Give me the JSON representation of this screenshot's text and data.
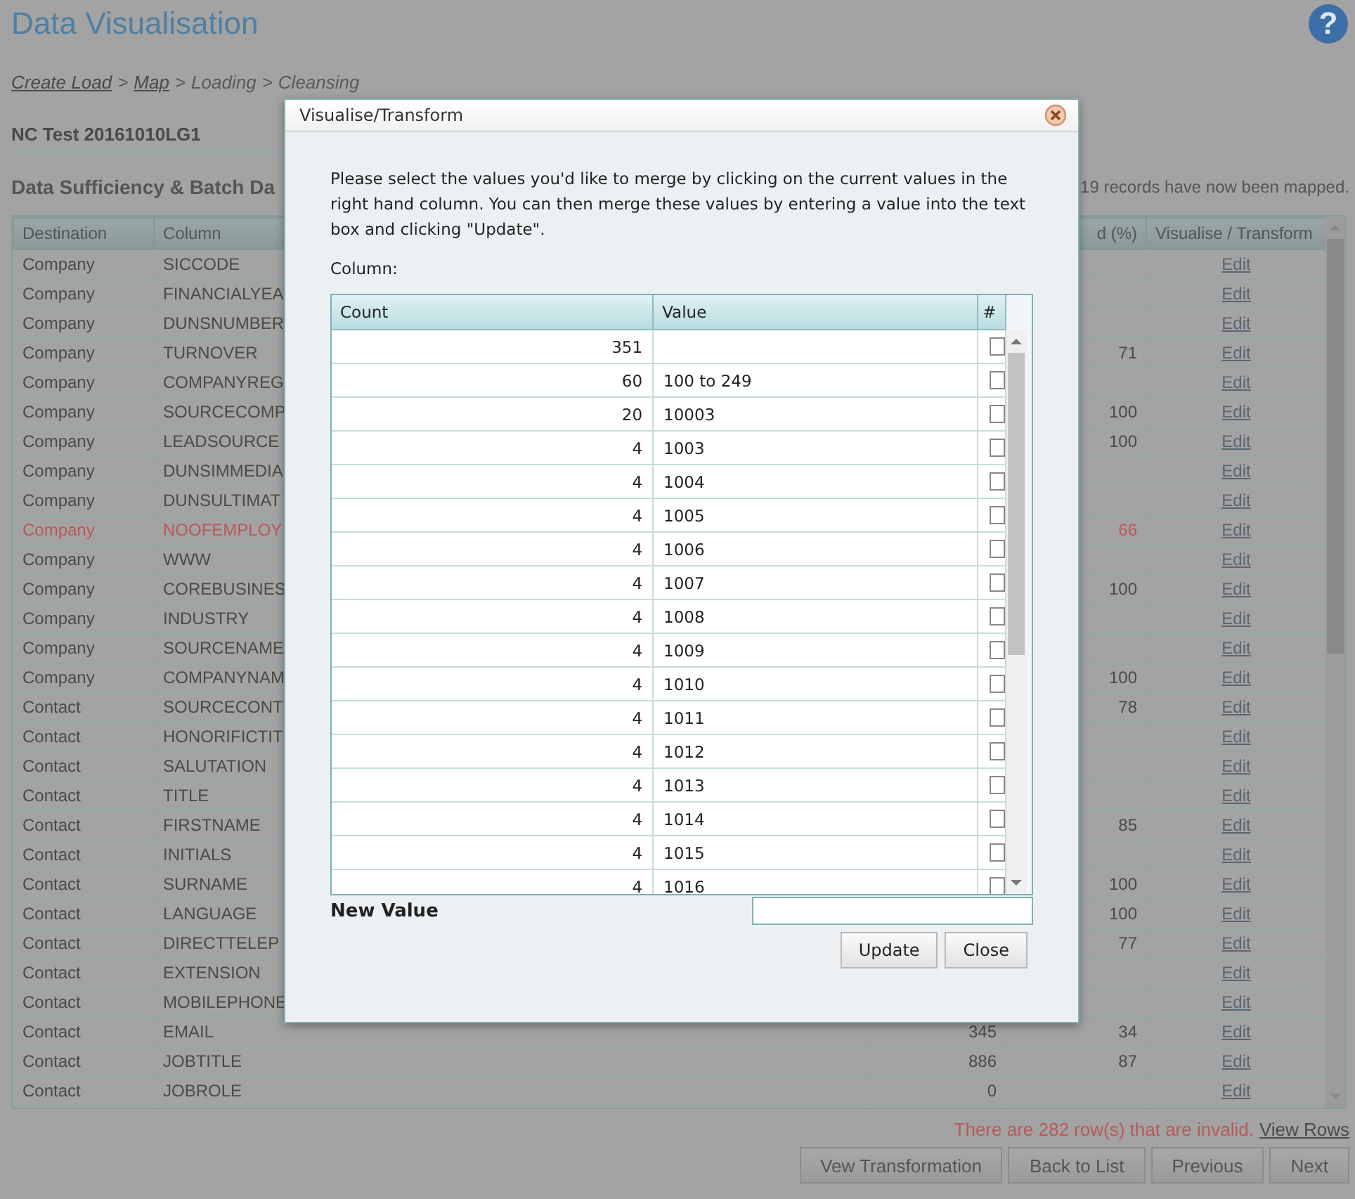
{
  "page": {
    "title": "Data Visualisation",
    "help_glyph": "?"
  },
  "breadcrumb": [
    {
      "label": "Create Load",
      "kind": "link"
    },
    {
      "label": ">",
      "kind": "separator"
    },
    {
      "label": "Map",
      "kind": "link"
    },
    {
      "label": ">",
      "kind": "separator"
    },
    {
      "label": "Loading",
      "kind": "text"
    },
    {
      "label": ">",
      "kind": "separator"
    },
    {
      "label": "Cleansing",
      "kind": "text"
    }
  ],
  "load_name": "NC Test 20161010LG1",
  "section": {
    "heading": "Data Sufficiency & Batch Da",
    "summary": "19 records have now been mapped."
  },
  "table": {
    "columns": [
      {
        "heading": "Destination"
      },
      {
        "heading": "Column"
      },
      {
        "heading": "d (%)"
      },
      {
        "heading": "Visualise / Transform"
      }
    ],
    "rows": [
      {
        "destination": "Company",
        "column": "SICCODE",
        "invalid": false,
        "action": "Edit"
      },
      {
        "destination": "Company",
        "column": "FINANCIALYEA",
        "invalid": false,
        "action": "Edit"
      },
      {
        "destination": "Company",
        "column": "DUNSNUMBER",
        "invalid": false,
        "action": "Edit"
      },
      {
        "destination": "Company",
        "column": "TURNOVER",
        "percent": "71",
        "invalid": false,
        "action": "Edit"
      },
      {
        "destination": "Company",
        "column": "COMPANYREG",
        "invalid": false,
        "action": "Edit"
      },
      {
        "destination": "Company",
        "column": "SOURCECOMP",
        "percent": "100",
        "invalid": false,
        "action": "Edit"
      },
      {
        "destination": "Company",
        "column": "LEADSOURCE",
        "percent": "100",
        "invalid": false,
        "action": "Edit"
      },
      {
        "destination": "Company",
        "column": "DUNSIMMEDIA",
        "invalid": false,
        "action": "Edit"
      },
      {
        "destination": "Company",
        "column": "DUNSULTIMAT",
        "invalid": false,
        "action": "Edit"
      },
      {
        "destination": "Company",
        "column": "NOOFEMPLOY",
        "percent": "66",
        "invalid": true,
        "action": "Edit"
      },
      {
        "destination": "Company",
        "column": "WWW",
        "invalid": false,
        "action": "Edit"
      },
      {
        "destination": "Company",
        "column": "COREBUSINES",
        "percent": "100",
        "invalid": false,
        "action": "Edit"
      },
      {
        "destination": "Company",
        "column": "INDUSTRY",
        "invalid": false,
        "action": "Edit"
      },
      {
        "destination": "Company",
        "column": "SOURCENAME",
        "invalid": false,
        "action": "Edit"
      },
      {
        "destination": "Company",
        "column": "COMPANYNAM",
        "percent": "100",
        "invalid": false,
        "action": "Edit"
      },
      {
        "destination": "Contact",
        "column": "SOURCECONT",
        "percent": "78",
        "invalid": false,
        "action": "Edit"
      },
      {
        "destination": "Contact",
        "column": "HONORIFICTIT",
        "invalid": false,
        "action": "Edit"
      },
      {
        "destination": "Contact",
        "column": "SALUTATION",
        "invalid": false,
        "action": "Edit"
      },
      {
        "destination": "Contact",
        "column": "TITLE",
        "invalid": false,
        "action": "Edit"
      },
      {
        "destination": "Contact",
        "column": "FIRSTNAME",
        "percent": "85",
        "invalid": false,
        "action": "Edit"
      },
      {
        "destination": "Contact",
        "column": "INITIALS",
        "invalid": false,
        "action": "Edit"
      },
      {
        "destination": "Contact",
        "column": "SURNAME",
        "percent": "100",
        "invalid": false,
        "action": "Edit"
      },
      {
        "destination": "Contact",
        "column": "LANGUAGE",
        "percent": "100",
        "invalid": false,
        "action": "Edit"
      },
      {
        "destination": "Contact",
        "column": "DIRECTTELEP",
        "percent": "77",
        "invalid": false,
        "action": "Edit"
      },
      {
        "destination": "Contact",
        "column": "EXTENSION",
        "invalid": false,
        "action": "Edit"
      },
      {
        "destination": "Contact",
        "column": "MOBILEPHONE",
        "invalid": false,
        "action": "Edit"
      },
      {
        "destination": "Contact",
        "column": "EMAIL",
        "count": "345",
        "percent": "34",
        "invalid": false,
        "action": "Edit"
      },
      {
        "destination": "Contact",
        "column": "JOBTITLE",
        "count": "886",
        "percent": "87",
        "invalid": false,
        "action": "Edit"
      },
      {
        "destination": "Contact",
        "column": "JOBROLE",
        "count": "0",
        "invalid": false,
        "action": "Edit"
      }
    ]
  },
  "invalid_notice": {
    "message": "There are 282 row(s) that are invalid.",
    "link": "View Rows"
  },
  "buttons": [
    "Vew Transformation",
    "Back to List",
    "Previous",
    "Next"
  ],
  "dialog": {
    "title": "Visualise/Transform",
    "instructions": "Please select the values you'd like to merge by clicking on the current values in the right hand column. You can then merge these values by entering a value into the text box and clicking \"Update\".",
    "column_label": "Column:",
    "grid": {
      "columns": [
        "Count",
        "Value",
        "#"
      ],
      "rows": [
        {
          "count": "351",
          "checked": false
        },
        {
          "count": "60",
          "value": "100 to 249",
          "checked": false
        },
        {
          "count": "20",
          "value": "10003",
          "checked": false
        },
        {
          "count": "4",
          "value": "1003",
          "checked": false
        },
        {
          "count": "4",
          "value": "1004",
          "checked": false
        },
        {
          "count": "4",
          "value": "1005",
          "checked": false
        },
        {
          "count": "4",
          "value": "1006",
          "checked": false
        },
        {
          "count": "4",
          "value": "1007",
          "checked": false
        },
        {
          "count": "4",
          "value": "1008",
          "checked": false
        },
        {
          "count": "4",
          "value": "1009",
          "checked": false
        },
        {
          "count": "4",
          "value": "1010",
          "checked": false
        },
        {
          "count": "4",
          "value": "1011",
          "checked": false
        },
        {
          "count": "4",
          "value": "1012",
          "checked": false
        },
        {
          "count": "4",
          "value": "1013",
          "checked": false
        },
        {
          "count": "4",
          "value": "1014",
          "checked": false
        },
        {
          "count": "4",
          "value": "1015",
          "checked": false
        },
        {
          "count": "4",
          "value": "1016",
          "checked": false
        }
      ]
    },
    "new_value_label": "New Value",
    "buttons": [
      "Update",
      "Close"
    ]
  }
}
